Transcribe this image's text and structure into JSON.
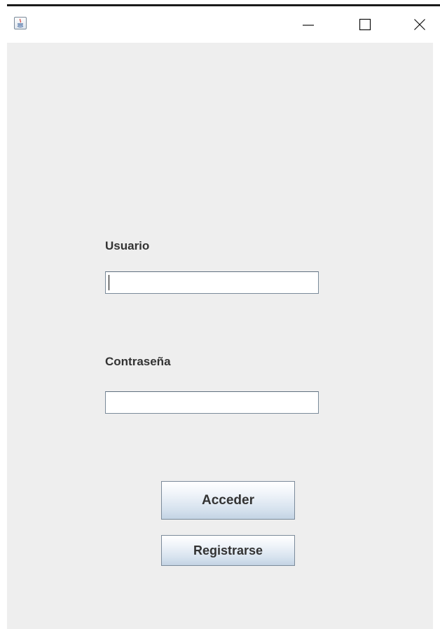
{
  "window": {
    "title": "",
    "icon": "java-icon",
    "controls": {
      "minimize_icon": "minimize-icon",
      "maximize_icon": "maximize-icon",
      "close_icon": "close-icon"
    }
  },
  "form": {
    "user_label": "Usuario",
    "user_value": "",
    "password_label": "Contraseña",
    "password_value": "",
    "login_button": "Acceder",
    "register_button": "Registrarse"
  },
  "colors": {
    "background": "#EEEEEE",
    "button_gradient_top": "#FFFFFF",
    "button_gradient_bottom": "#C3D3E4",
    "text": "#333333"
  }
}
